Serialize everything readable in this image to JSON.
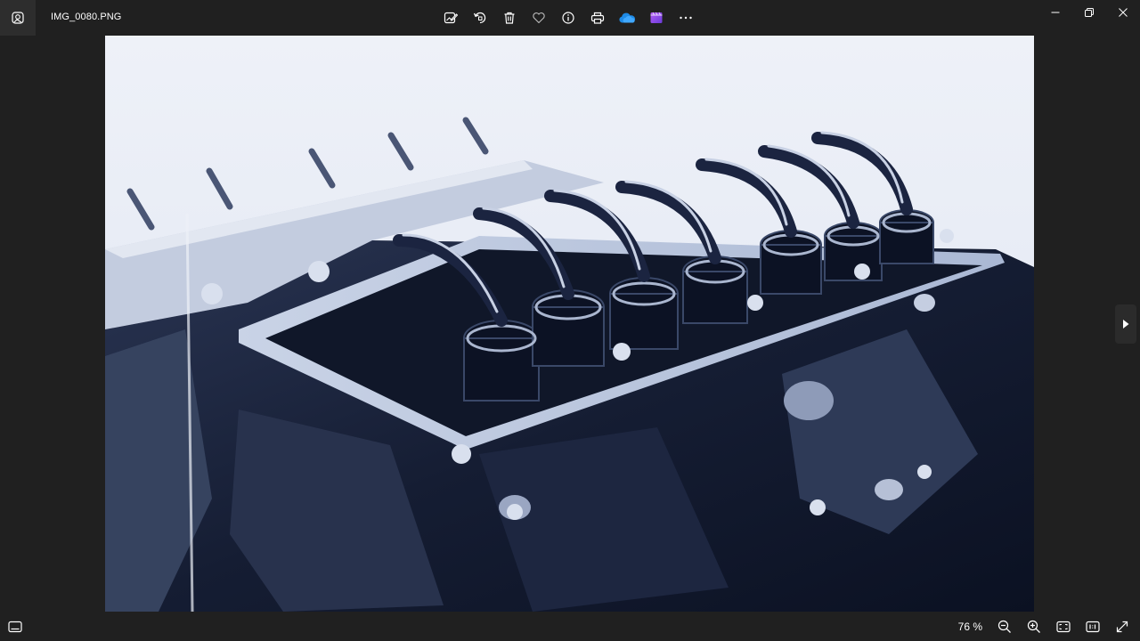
{
  "window": {
    "file_name": "IMG_0080.PNG"
  },
  "toolbar": {
    "buttons": [
      {
        "name": "edit-image",
        "icon": "edit-image-icon"
      },
      {
        "name": "rotate",
        "icon": "rotate-icon"
      },
      {
        "name": "delete",
        "icon": "trash-icon"
      },
      {
        "name": "favorite",
        "icon": "heart-icon"
      },
      {
        "name": "file-info",
        "icon": "info-icon"
      },
      {
        "name": "print",
        "icon": "printer-icon"
      },
      {
        "name": "onedrive",
        "icon": "cloud-icon"
      },
      {
        "name": "clipchamp",
        "icon": "clipchamp-icon"
      },
      {
        "name": "see-more",
        "icon": "more-icon"
      }
    ]
  },
  "statusbar": {
    "zoom_level": "76 %"
  },
  "colors": {
    "background": "#202020",
    "onedrive_blue": "#1e8ae6",
    "clipchamp_purple": "#8a4cf0"
  }
}
